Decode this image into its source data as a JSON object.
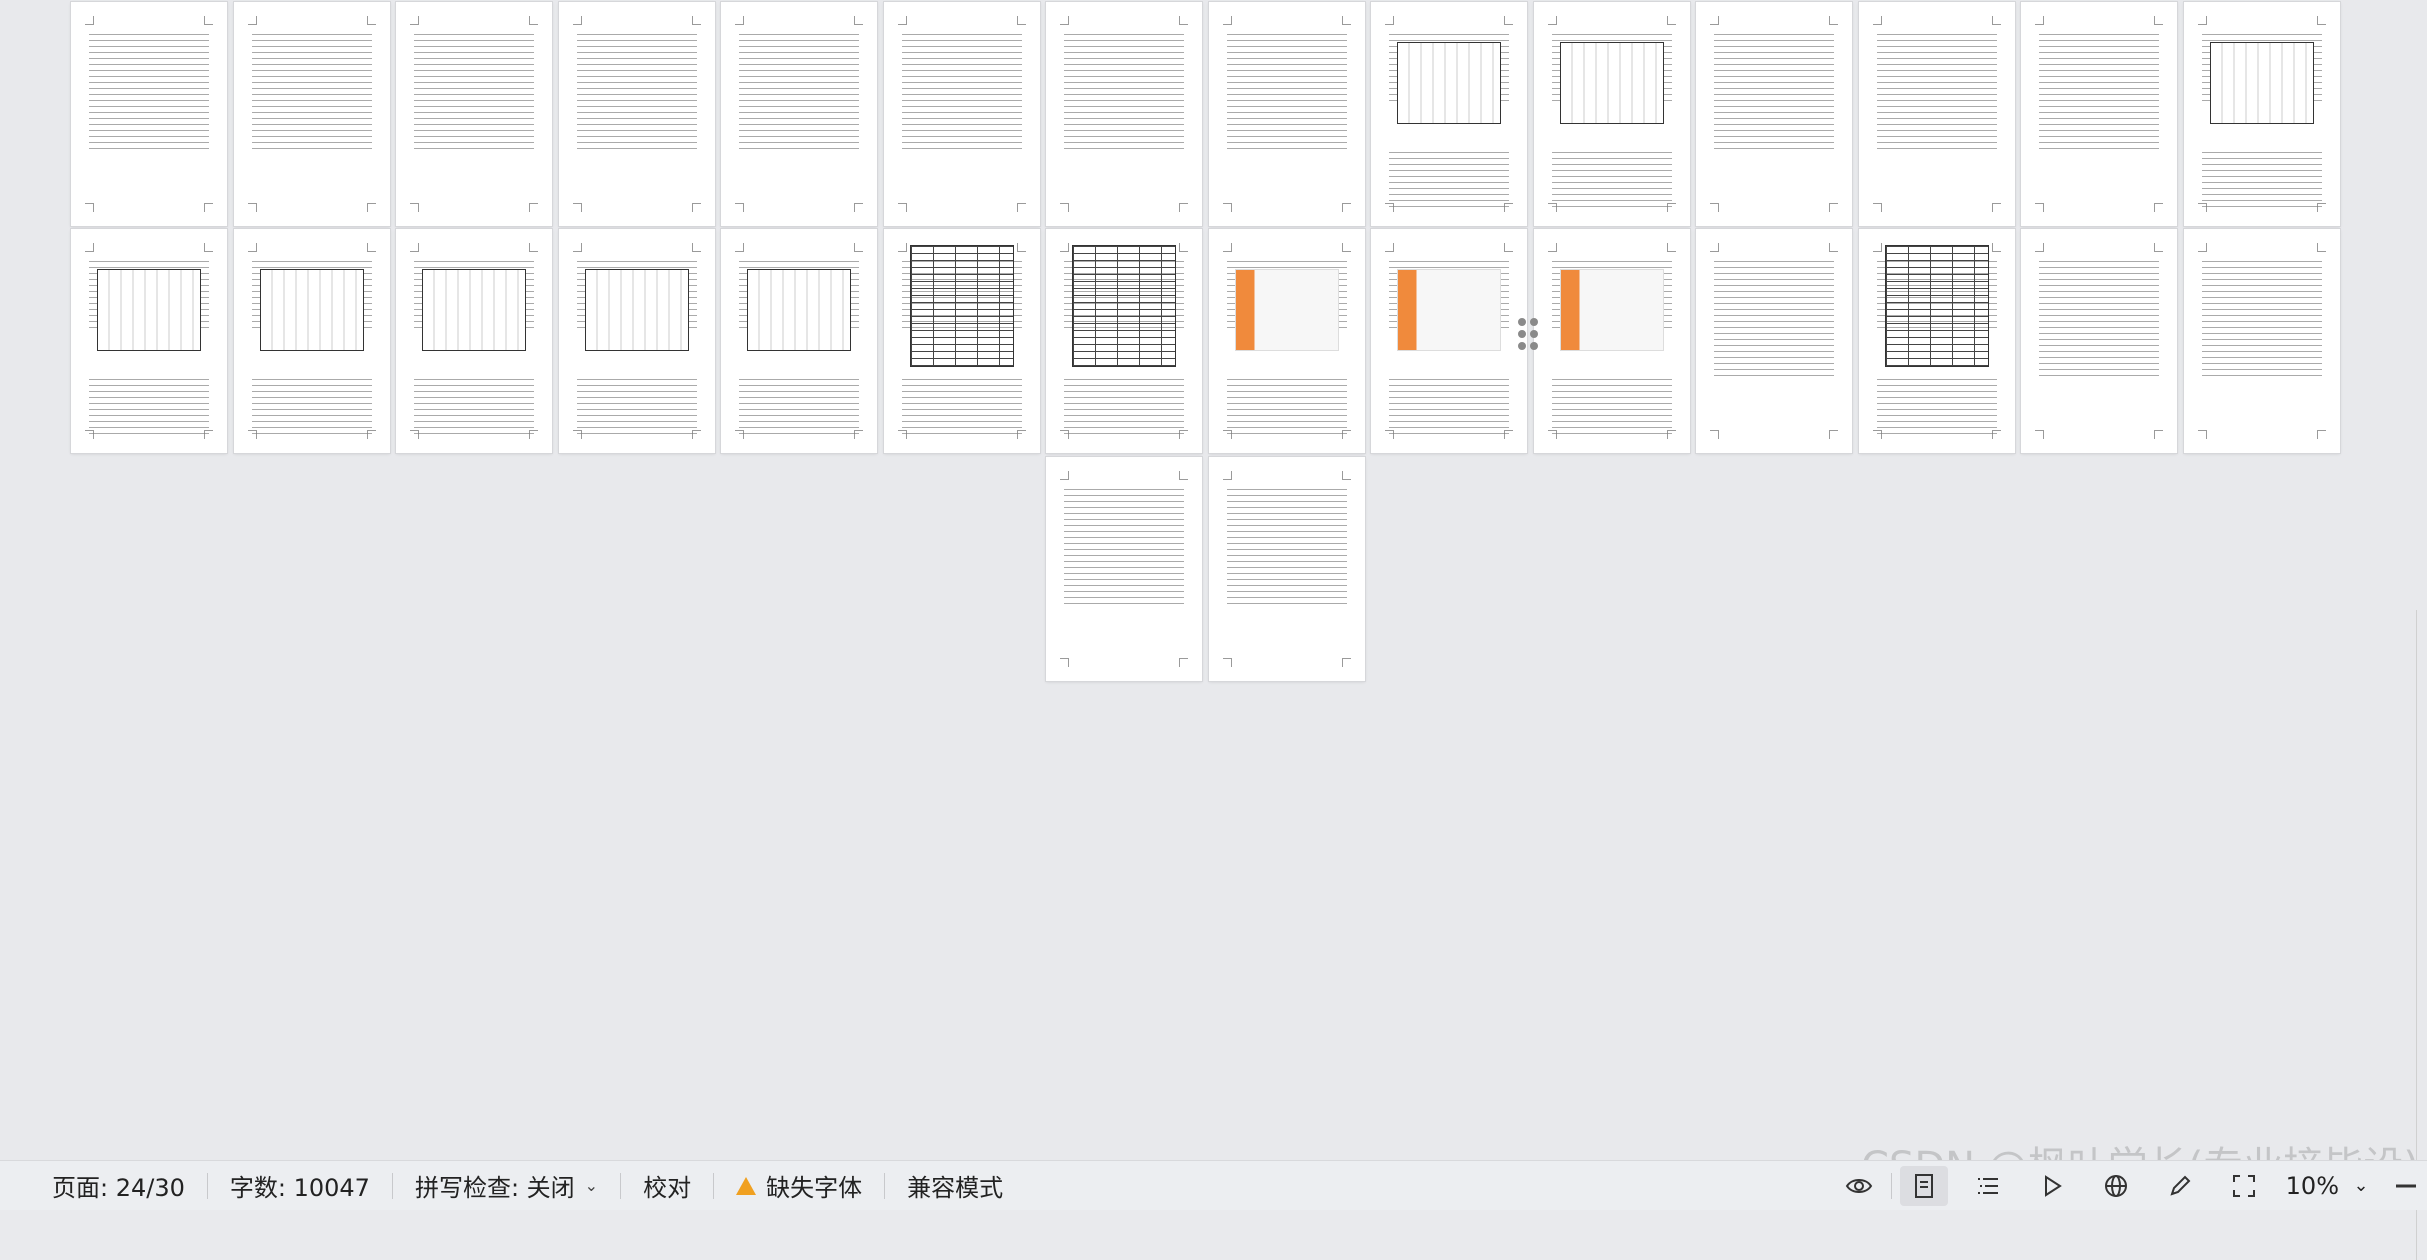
{
  "status_bar": {
    "page_indicator": "页面: 24/30",
    "word_count": "字数: 10047",
    "spell_check": "拼写检查: 关闭",
    "proofread": "校对",
    "missing_fonts": "缺失字体",
    "compat_mode": "兼容模式",
    "zoom_level": "10%"
  },
  "watermark": "CSDN @枫叶学长(专业接毕设)",
  "icons": {
    "eye": "eye-icon",
    "page_view": "page-view-icon",
    "outline": "outline-icon",
    "play": "play-icon",
    "web": "globe-icon",
    "pen": "pen-icon",
    "fit": "fit-page-icon",
    "zoom_dropdown": "chevron-down-icon",
    "zoom_out": "minus-icon"
  },
  "colors": {
    "background": "#e8e9ec",
    "status_bar": "#eceef1",
    "warning": "#f0a020"
  },
  "pages_total": 30
}
